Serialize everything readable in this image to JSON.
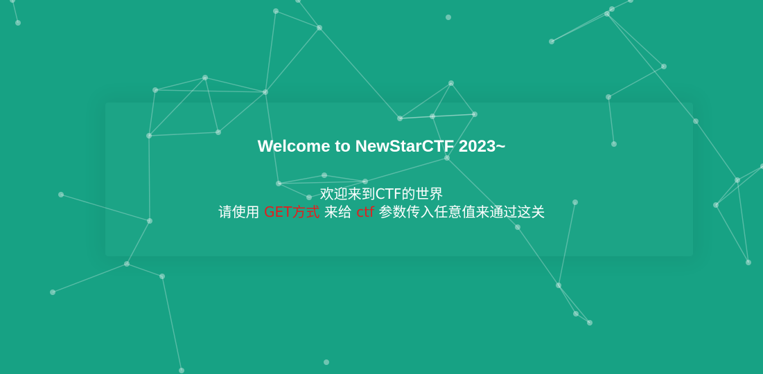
{
  "page": {
    "title": "Welcome to NewStarCTF 2023~",
    "welcome_line": "欢迎来到CTF的世界",
    "instruction": {
      "prefix": "请使用 ",
      "method": "GET方式",
      "middle": " 来给 ",
      "param": "ctf",
      "suffix": " 参数传入任意值来通过这关"
    }
  },
  "colors": {
    "background": "#17a284",
    "text": "#ffffff",
    "highlight": "#e51c1c",
    "network": "rgba(255,255,255,0.35)"
  }
}
